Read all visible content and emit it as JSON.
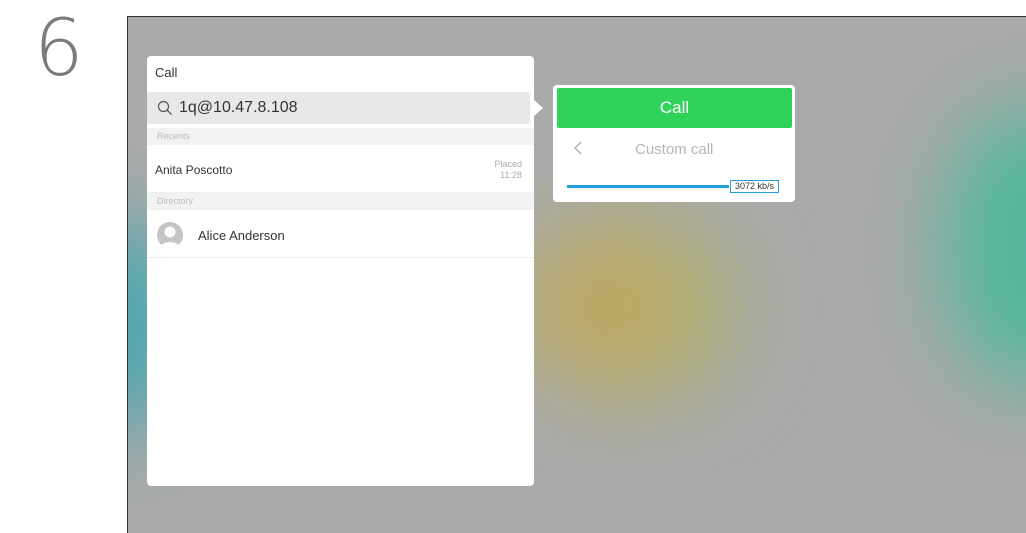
{
  "step": {
    "number": "6"
  },
  "call_panel": {
    "title": "Call",
    "search": {
      "value": "1q@10.47.8.108"
    },
    "recents": {
      "label": "Recents",
      "items": [
        {
          "name": "Anita Poscotto",
          "status": "Placed",
          "time": "11:28"
        }
      ]
    },
    "directory": {
      "label": "Directory",
      "items": [
        {
          "name": "Alice Anderson"
        }
      ]
    }
  },
  "call_menu": {
    "call_label": "Call",
    "custom_call_label": "Custom call",
    "bandwidth": {
      "value_label": "3072 kb/s",
      "level": 1.0
    }
  },
  "colors": {
    "call_button": "#2fd35b",
    "slider_accent": "#1f9ee0",
    "screen_background": "#aaaaaa"
  },
  "icons": [
    "search-icon",
    "chevron-left-icon",
    "avatar-placeholder-icon"
  ]
}
